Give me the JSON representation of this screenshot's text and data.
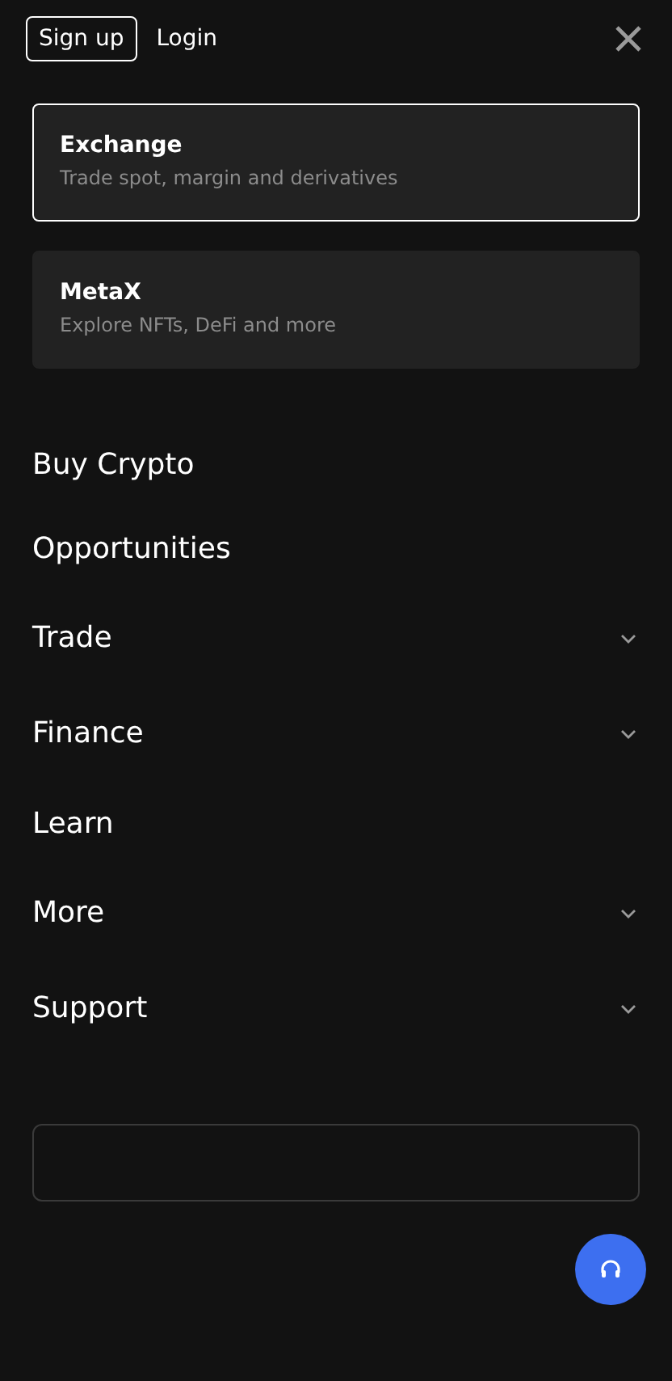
{
  "header": {
    "signup": "Sign up",
    "login": "Login"
  },
  "products": [
    {
      "title": "Exchange",
      "subtitle": "Trade spot, margin and derivatives",
      "selected": true
    },
    {
      "title": "MetaX",
      "subtitle": "Explore NFTs, DeFi and more",
      "selected": false
    }
  ],
  "menu": [
    {
      "label": "Buy Crypto",
      "kind": "link"
    },
    {
      "label": "Opportunities",
      "kind": "link"
    },
    {
      "label": "Trade",
      "kind": "group"
    },
    {
      "label": "Finance",
      "kind": "group"
    },
    {
      "label": "Learn",
      "kind": "link"
    },
    {
      "label": "More",
      "kind": "group"
    },
    {
      "label": "Support",
      "kind": "group"
    }
  ]
}
